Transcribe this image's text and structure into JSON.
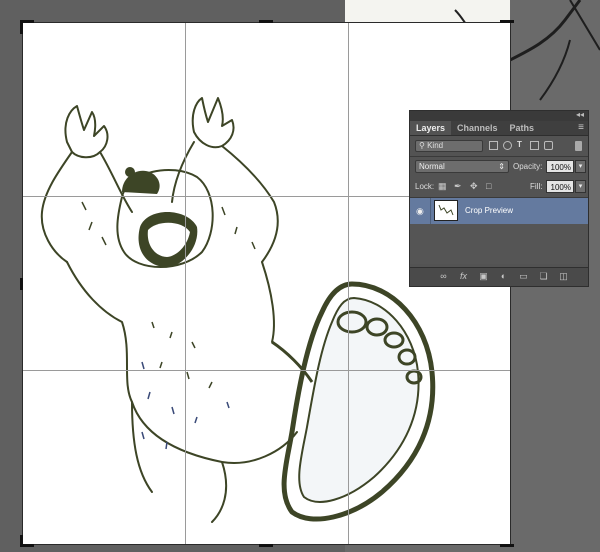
{
  "panel": {
    "tabs": [
      "Layers",
      "Channels",
      "Paths"
    ],
    "active_tab": "Layers",
    "filter_kind": "Kind",
    "blend_mode": "Normal",
    "opacity_label": "Opacity:",
    "opacity_value": "100%",
    "lock_label": "Lock:",
    "fill_label": "Fill:",
    "fill_value": "100%",
    "layers": [
      {
        "name": "Crop Preview",
        "visible": true,
        "selected": true
      }
    ],
    "bottom_icons": [
      "link-icon",
      "fx-icon",
      "mask-icon",
      "adjustment-icon",
      "folder-icon",
      "new-layer-icon",
      "trash-icon"
    ]
  },
  "colors": {
    "panel_bg": "#535353",
    "selected_layer": "#647a9f",
    "ink": "#3d4526",
    "workspace": "#606060"
  }
}
